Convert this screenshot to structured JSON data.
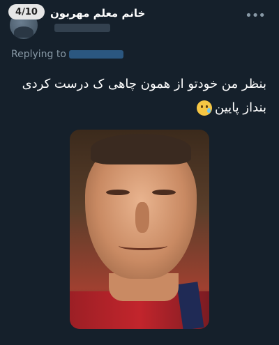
{
  "image_counter": "4/10",
  "tweet": {
    "display_name": "خانم معلم مهربون",
    "replying_to_label": "Replying to",
    "text_line1": "بنظر من خودتو از همون چاهی ک درست کردی",
    "text_line2": "بنداز پایین"
  },
  "icons": {
    "more": "more-dots-icon",
    "emoji": "face-holding-back-tears-emoji"
  },
  "colors": {
    "background": "#15202b",
    "secondary_text": "#8899a6",
    "link_blue": "#1d9bf0"
  }
}
